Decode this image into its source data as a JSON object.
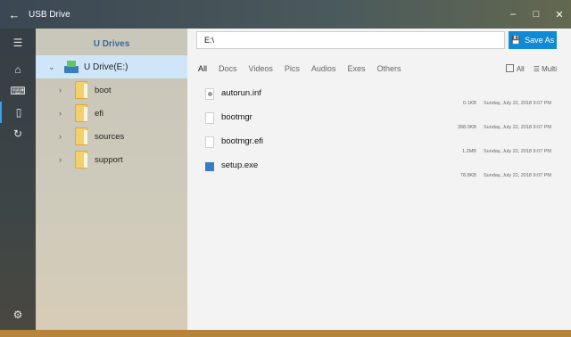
{
  "window": {
    "title": "USB Drive",
    "back_icon": "back-arrow-icon",
    "min": "–",
    "max": "□",
    "close": "✕"
  },
  "rail": {
    "menu": "☰",
    "home": "⌂",
    "keyboard": "⌨",
    "usb": "▯",
    "history": "↻",
    "settings": "⚙"
  },
  "nav": {
    "header": "U Drives",
    "root": {
      "label": "U Drive(E:)",
      "chev": "⌄"
    },
    "folders": [
      {
        "name": "boot",
        "chev": "›"
      },
      {
        "name": "efi",
        "chev": "›"
      },
      {
        "name": "sources",
        "chev": "›"
      },
      {
        "name": "support",
        "chev": "›"
      }
    ]
  },
  "path": {
    "value": "E:\\"
  },
  "toolbar": {
    "save_label": "Save As",
    "save_icon": "💾"
  },
  "tabs": [
    "All",
    "Docs",
    "Videos",
    "Pics",
    "Audios",
    "Exes",
    "Others"
  ],
  "view": {
    "all_label": "All",
    "multi_label": "Multi"
  },
  "files": [
    {
      "name": "autorun.inf",
      "size": "0.1KB",
      "date": "Sunday, July 22, 2018 9:07 PM",
      "type": "inf"
    },
    {
      "name": "bootmgr",
      "size": "398.0KB",
      "date": "Sunday, July 22, 2018 9:07 PM",
      "type": "file"
    },
    {
      "name": "bootmgr.efi",
      "size": "1.2MB",
      "date": "Sunday, July 22, 2018 9:07 PM",
      "type": "file"
    },
    {
      "name": "setup.exe",
      "size": "78.8KB",
      "date": "Sunday, July 22, 2018 9:07 PM",
      "type": "exe"
    }
  ],
  "colors": {
    "accent": "#0f8ad6",
    "selected": "#cfe6f9"
  }
}
